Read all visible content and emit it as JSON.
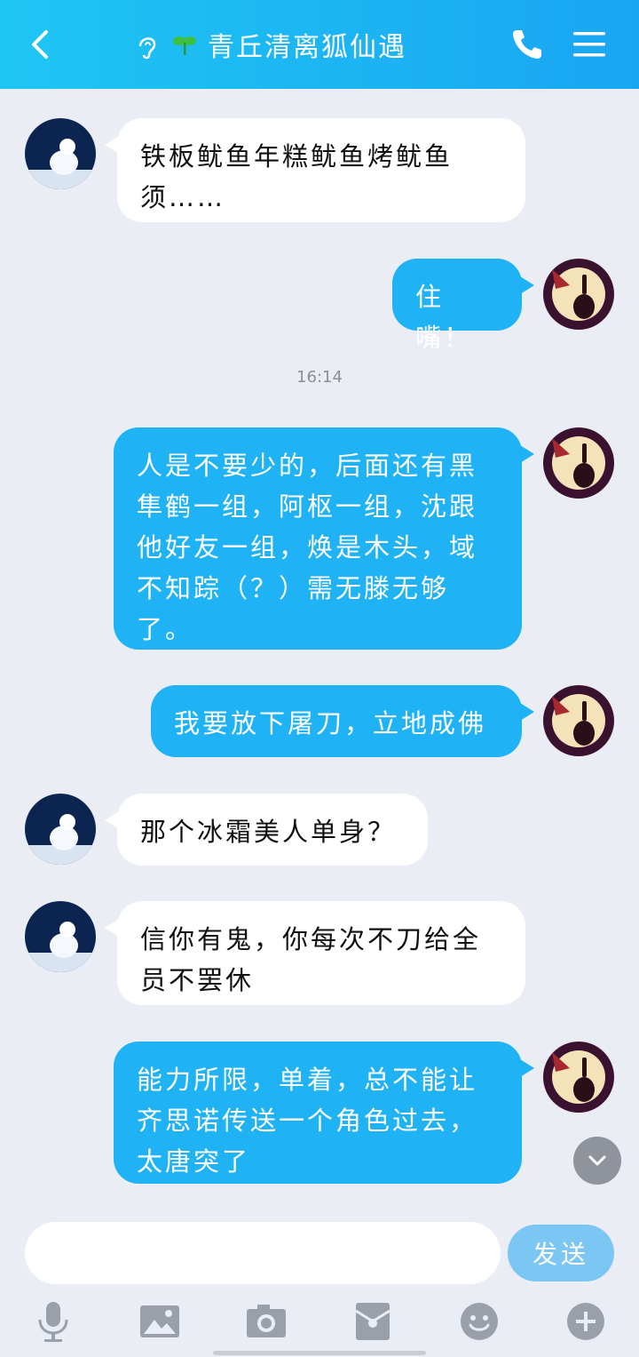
{
  "header": {
    "title": "青丘清离狐仙遇",
    "colors": {
      "start": "#1ec6f3",
      "end": "#1aa5f3"
    }
  },
  "timestamp": "16:14",
  "messages": [
    {
      "side": "in",
      "text": "铁板鱿鱼年糕鱿鱼烤鱿鱼须……"
    },
    {
      "side": "out",
      "text": "住嘴！"
    },
    {
      "side": "out",
      "text": "人是不要少的，后面还有黑隼鹤一组，阿枢一组，沈跟他好友一组，焕是木头，域不知踪（？）需无滕无够了。"
    },
    {
      "side": "out",
      "text": "我要放下屠刀，立地成佛"
    },
    {
      "side": "in",
      "text": "那个冰霜美人单身？"
    },
    {
      "side": "in",
      "text": "信你有鬼，你每次不刀给全员不罢休"
    },
    {
      "side": "out",
      "text": "能力所限，单着，总不能让齐思诺传送一个角色过去，太唐突了"
    }
  ],
  "input": {
    "placeholder": "",
    "value": ""
  },
  "send_label": "发送",
  "toolbar": [
    "microphone-icon",
    "image-icon",
    "camera-icon",
    "red-packet-icon",
    "emoji-icon",
    "plus-icon"
  ]
}
